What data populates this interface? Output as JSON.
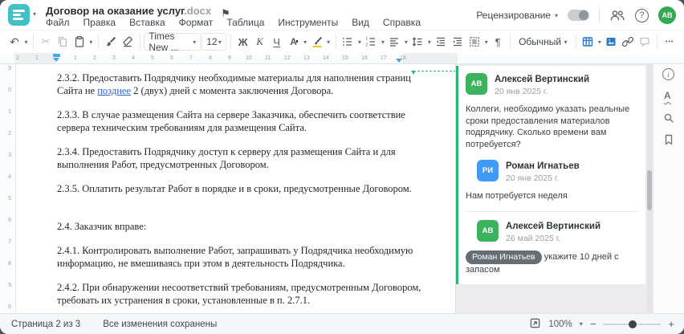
{
  "window": {
    "title": "Договор на оказание услуг",
    "title_ext": ".docx"
  },
  "menu": {
    "items": [
      "Файл",
      "Правка",
      "Вставка",
      "Формат",
      "Таблица",
      "Инструменты",
      "Вид",
      "Справка"
    ]
  },
  "header": {
    "review_label": "Рецензирование",
    "avatar_initials": "АВ"
  },
  "icons": {
    "undo": "↶",
    "cut": "✂",
    "flag": "⚑",
    "help": "?",
    "info": "i",
    "spellcheck_letter": "А",
    "more": "•••"
  },
  "toolbar": {
    "font_name": "Times New ...",
    "font_size": "12",
    "bold": "Ж",
    "italic": "К",
    "underline": "Ч",
    "font_color": "А",
    "style_name": "Обычный",
    "pilcrow": "¶"
  },
  "ruler": {
    "h_negative": [
      "2",
      "1"
    ],
    "h_positive": [
      "1",
      "2",
      "3",
      "4",
      "5",
      "6",
      "7",
      "8",
      "9",
      "10",
      "11",
      "12",
      "13",
      "14",
      "15",
      "16",
      "17",
      "18"
    ],
    "v_numbers": [
      "9",
      "0",
      "1",
      "2",
      "3",
      "4",
      "5",
      "6",
      "7",
      "8",
      "9",
      "0"
    ]
  },
  "document": {
    "p1a": "2.3.2. Предоставить Подрядчику необходимые материалы для наполнения страниц Сайта не ",
    "p1_ins": "позднее",
    "p1b": " 2 (двух) дней с момента заключения Договора.",
    "p2": "2.3.3. В случае размещения Сайта на сервере Заказчика, обеспечить соответствие сервера техническим требованиям для размещения Сайта.",
    "p3": "2.3.4. Предоставить Подрядчику доступ к серверу для размещения Сайта и для выполнения Работ, предусмотренных Договором.",
    "p4": "2.3.5. Оплатить результат Работ в порядке и в сроки, предусмотренные Договором.",
    "p5": "2.4. Заказчик вправе:",
    "p6": "2.4.1. Контролировать выполнение Работ, запрашивать у Подрядчика необходимую информацию, не вмешиваясь при этом в деятельность Подрядчика.",
    "p7": "2.4.2. При обнаружении несоответствий требованиям, предусмотренным Договором, требовать их устранения в сроки, установленные в п. 2.7.1."
  },
  "comments": {
    "c1": {
      "initials": "АВ",
      "name": "Алексей Вертинский",
      "date": "20 янв 2025 г.",
      "text": "Коллеги, необходимо указать реальные сроки предоставления материалов подрядчику. Сколько времени вам потребуется?"
    },
    "c2": {
      "initials": "РИ",
      "name": "Роман Игнатьев",
      "date": "20 янв 2025 г.",
      "text": "Нам потребуется неделя"
    },
    "c3": {
      "initials": "АВ",
      "name": "Алексей Вертинский",
      "date": "26 май 2025 г.",
      "mention": "Роман Игнатьев",
      "text": " укажите 10 дней с запасом"
    }
  },
  "statusbar": {
    "page": "Страница 2 из 3",
    "saved": "Все изменения сохранены",
    "zoom": "100%"
  },
  "colors": {
    "brand_teal": "#41c0c8",
    "avatar_green": "#3bb35f",
    "avatar_blue": "#3e9cf6",
    "comment_green": "#2eb574",
    "inserted_text_blue": "#3763c8",
    "accent_icon_blue": "#2e77cc",
    "ruler_marker_blue": "#46a6e8"
  }
}
